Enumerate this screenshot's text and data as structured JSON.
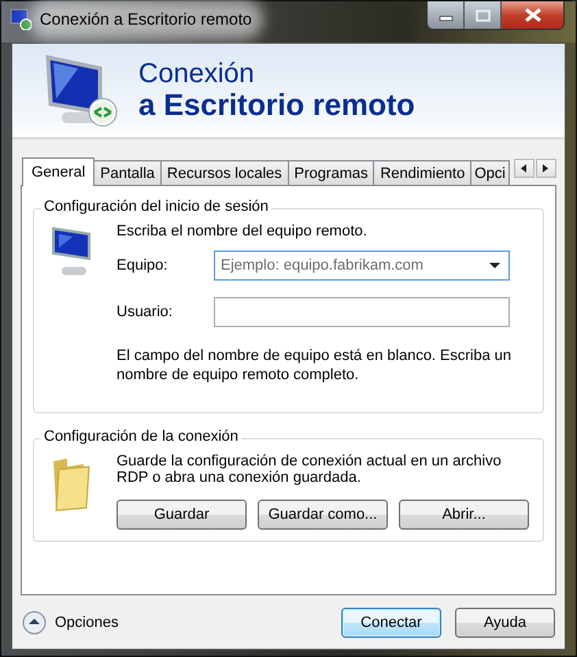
{
  "window": {
    "title": "Conexión a Escritorio remoto"
  },
  "banner": {
    "line_1": "Conexión",
    "line_2": "a Escritorio remoto"
  },
  "tabs": [
    {
      "label": "General",
      "selected": true
    },
    {
      "label": "Pantalla",
      "selected": false
    },
    {
      "label": "Recursos locales",
      "selected": false
    },
    {
      "label": "Programas",
      "selected": false
    },
    {
      "label": "Rendimiento",
      "selected": false
    },
    {
      "label": "Opci",
      "selected": false
    }
  ],
  "login_group": {
    "title": "Configuración del inicio de sesión",
    "prompt": "Escriba el nombre del equipo remoto.",
    "fields": [
      {
        "label": "Equipo:",
        "placeholder": "Ejemplo: equipo.fabrikam.com",
        "kind": "combo"
      },
      {
        "label": "Usuario:",
        "kind": "text"
      }
    ],
    "message": "El campo del nombre de equipo está en blanco. Escriba un nombre de equipo remoto completo."
  },
  "connection_group": {
    "title": "Configuración de la conexión",
    "text": "Guarde la configuración de conexión actual en un archivo RDP o abra una conexión guardada.",
    "buttons": [
      "Guardar",
      "Guardar como...",
      "Abrir..."
    ]
  },
  "options": {
    "label": "Opciones",
    "expanded": true
  },
  "buttons": [
    {
      "label": "Conectar",
      "default": true
    },
    {
      "label": "Ayuda",
      "default": false
    }
  ]
}
